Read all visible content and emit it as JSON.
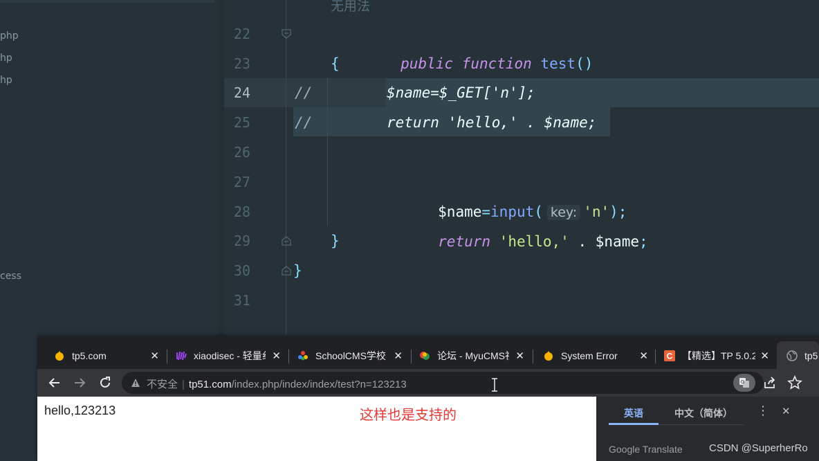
{
  "ide": {
    "sidebar_files": [
      "php",
      "hp",
      "hp",
      "cess"
    ],
    "line_numbers": [
      "22",
      "23",
      "24",
      "25",
      "26",
      "27",
      "28",
      "29",
      "30",
      "31"
    ],
    "partial_comment": "无用法",
    "code": {
      "l22_kw1": "public",
      "l22_kw2": "function",
      "l22_fn": "test",
      "l22_paren": "()",
      "l23": "{",
      "l24_comment": "//",
      "l24_code": "$name=$_GET['n'];",
      "l25_comment": "//",
      "l25_code": "return 'hello,' . $name;",
      "l27_var": "$name",
      "l27_eq": "=",
      "l27_fn": "input",
      "l27_open": "(",
      "l27_hint": "key:",
      "l27_str": "'n'",
      "l27_close": ");",
      "l28_kw": "return",
      "l28_str": "'hello,'",
      "l28_dot": " . ",
      "l28_var": "$name",
      "l28_semi": ";",
      "l29": "}",
      "l30": "}"
    }
  },
  "browser": {
    "tabs": [
      {
        "title": "tp5.com",
        "close": "✕",
        "favicon_color": "#f4b400"
      },
      {
        "title": "xiaodisec - 轻量纟",
        "close": "✕",
        "favicon_color": "#a142f4"
      },
      {
        "title": "SchoolCMS学校",
        "close": "✕",
        "favicon_color": "#4285f4"
      },
      {
        "title": "论坛 - MyuCMS社",
        "close": "✕",
        "favicon_color": "#34a853"
      },
      {
        "title": "System Error",
        "close": "✕",
        "favicon_color": "#f4b400"
      },
      {
        "title": "【精选】TP 5.0.2",
        "close": "✕",
        "favicon_color": "#e8643b"
      },
      {
        "title": "tp5",
        "close": "",
        "favicon_color": "#9aa0a6"
      }
    ],
    "address": {
      "security_label": "不安全",
      "host": "tp51.com",
      "path": "/index.php/index/index/test?n=123213"
    },
    "page_text": "hello,123213",
    "annotation": "这样也是支持的",
    "translate": {
      "source_lang": "英语",
      "target_lang": "中文（简体）",
      "footer": "Google Translate",
      "menu_icon": "⋮",
      "close_icon": "✕"
    }
  },
  "watermark": "CSDN @SuperherRo"
}
